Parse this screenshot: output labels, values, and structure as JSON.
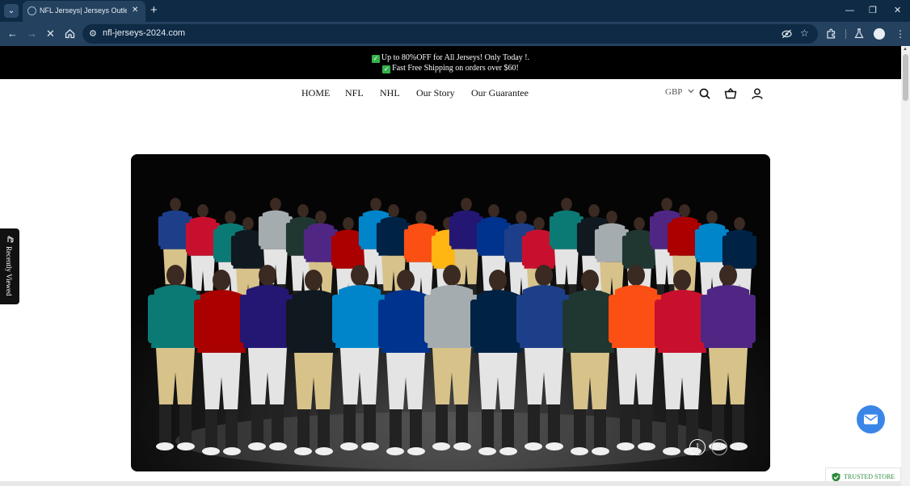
{
  "browser": {
    "tab_title": "NFL Jerseys| Jerseys Outlets| Ch",
    "tab_close": "✕",
    "new_tab": "+",
    "url": "nfl-jerseys-2024.com",
    "icons": [
      "tab-search-icon",
      "back-icon",
      "forward-icon",
      "stop-loading-icon",
      "home-icon",
      "site-info-icon",
      "eye-off-icon",
      "bookmark-star-icon",
      "extensions-icon",
      "labs-icon",
      "profile-icon",
      "menu-icon",
      "minimize-icon",
      "restore-icon",
      "close-icon"
    ]
  },
  "announcement": {
    "line1": "Up to 80%OFF for All Jerseys! Only Today !.",
    "line2": "Fast Free Shipping on orders over $60!"
  },
  "nav": {
    "items": [
      "HOME",
      "NFL",
      "NHL",
      "Our Story",
      "Our Guarantee"
    ]
  },
  "header": {
    "currency": "GBP"
  },
  "hero": {
    "image_alt": "NFL players in team jerseys standing together",
    "slides": [
      "1",
      "2"
    ],
    "active_slide": "1"
  },
  "recently_viewed": {
    "label": "Recently Viewed"
  },
  "trust_badge": {
    "label": "TRUSTED STORE"
  },
  "colors": {
    "browser_dark": "#0e2a45",
    "browser_toolbar": "#24425f",
    "announce_bg": "#000000",
    "check_green": "#35b24a",
    "chat_blue": "#3a86e8",
    "trusted_green": "#2d8b3c"
  }
}
